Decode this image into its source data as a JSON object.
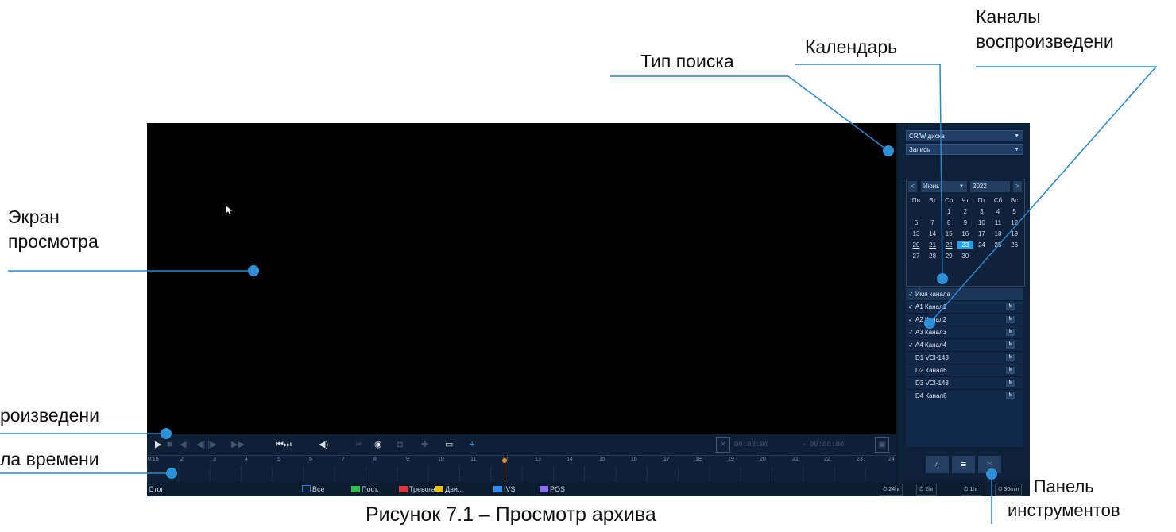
{
  "annotations": {
    "search_type": "Тип поиска",
    "calendar": "Календарь",
    "channels": "Каналы\nвоспроизведени",
    "view_screen": "Экран\nпросмотра",
    "playback_controls": "роизведени",
    "timeline": "ла времени",
    "toolbar": "Панель\nинструментов",
    "caption": "Рисунок 7.1 – Просмотр архива"
  },
  "search": {
    "source": "CR/W диска",
    "record_type": "Запись"
  },
  "calendar": {
    "month": "Июнь",
    "year": "2022",
    "weekdays": [
      "Пн",
      "Вт",
      "Ср",
      "Чт",
      "Пт",
      "Сб",
      "Вс"
    ],
    "first_weekday_index": 2,
    "days_in_month": 30,
    "selected_day": 23,
    "recorded_days": [
      10,
      14,
      15,
      16,
      20,
      21,
      22,
      23
    ]
  },
  "channels": {
    "header": "Имя канала",
    "items": [
      {
        "name": "A1 Канал1",
        "checked": true
      },
      {
        "name": "A2 Канал2",
        "checked": true
      },
      {
        "name": "A3 Канал3",
        "checked": true
      },
      {
        "name": "A4 Канал4",
        "checked": true
      },
      {
        "name": "D1 VCI-143",
        "checked": false
      },
      {
        "name": "D2 Канал6",
        "checked": false
      },
      {
        "name": "D3 VCI-143",
        "checked": false
      },
      {
        "name": "D4 Канал8",
        "checked": false
      }
    ],
    "mode_badge": "M"
  },
  "controls": {
    "start_time": "00:00:00",
    "end_time": "00:00:00",
    "separator": "-"
  },
  "timeline": {
    "ticks": [
      "0:15",
      "2",
      "3",
      "4",
      "5",
      "6",
      "7",
      "8",
      "9",
      "10",
      "11",
      "12",
      "13",
      "14",
      "15",
      "16",
      "17",
      "18",
      "19",
      "20",
      "21",
      "22",
      "23",
      "24"
    ]
  },
  "statusbar": {
    "state": "Стоп",
    "filters": [
      {
        "label": "Все",
        "color": "#2f7ed8"
      },
      {
        "label": "Пост.",
        "color": "#27c44a"
      },
      {
        "label": "Тревога",
        "color": "#e2323c"
      },
      {
        "label": "Дви...",
        "color": "#e6c21f"
      },
      {
        "label": "IVS",
        "color": "#2e8df2"
      },
      {
        "label": "POS",
        "color": "#8a6df0"
      }
    ],
    "ranges": [
      "24hr",
      "2hr",
      "1hr",
      "30min"
    ]
  },
  "colors": {
    "accent": "#1fa0ff",
    "annotation_line": "#2a86c8",
    "marker": "#d07a2a"
  }
}
